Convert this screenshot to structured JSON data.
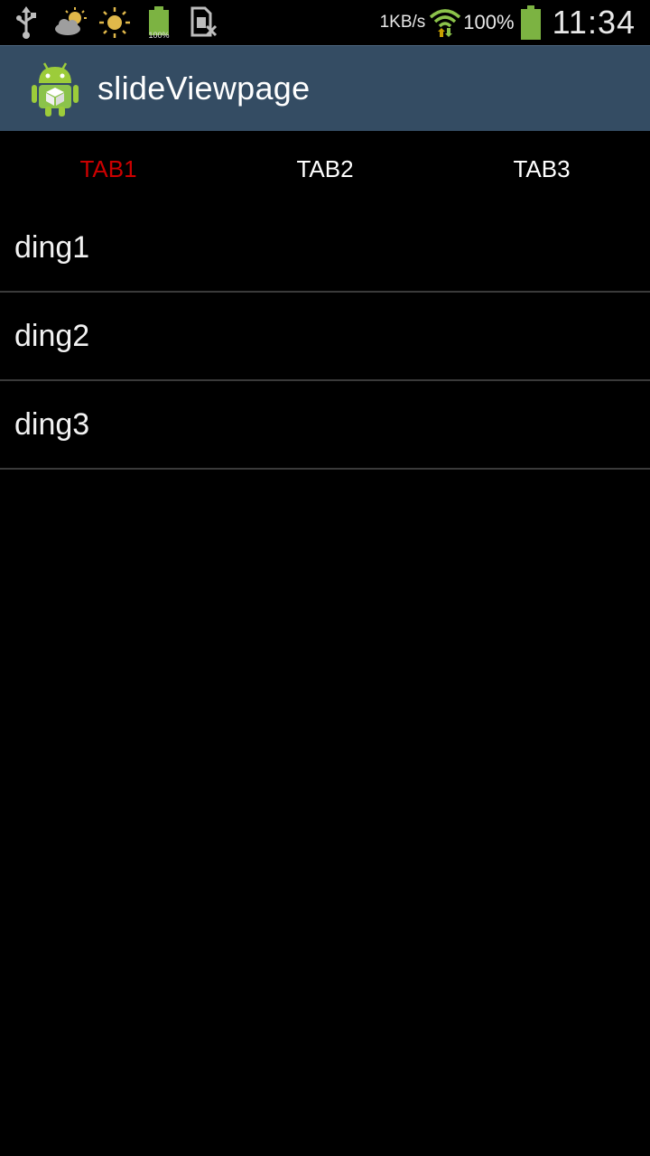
{
  "status_bar": {
    "icons_left": [
      "usb-icon",
      "partly-cloudy-icon",
      "sun-icon",
      "battery-full-icon",
      "sim-error-icon"
    ],
    "battery_icon_label": "100%",
    "net_speed": "1KB/s",
    "battery_percent": "100%",
    "time": "11:34",
    "colors": {
      "wifi": "#8bc34a",
      "battery": "#7cb342",
      "weather": "#e0b84a"
    }
  },
  "action_bar": {
    "title": "slideViewpage",
    "background": "#344c63"
  },
  "tabs": [
    {
      "label": "TAB1",
      "active": true
    },
    {
      "label": "TAB2",
      "active": false
    },
    {
      "label": "TAB3",
      "active": false
    }
  ],
  "active_tab_color": "#cc0000",
  "list": {
    "items": [
      {
        "label": "ding1"
      },
      {
        "label": "ding2"
      },
      {
        "label": "ding3"
      }
    ]
  }
}
